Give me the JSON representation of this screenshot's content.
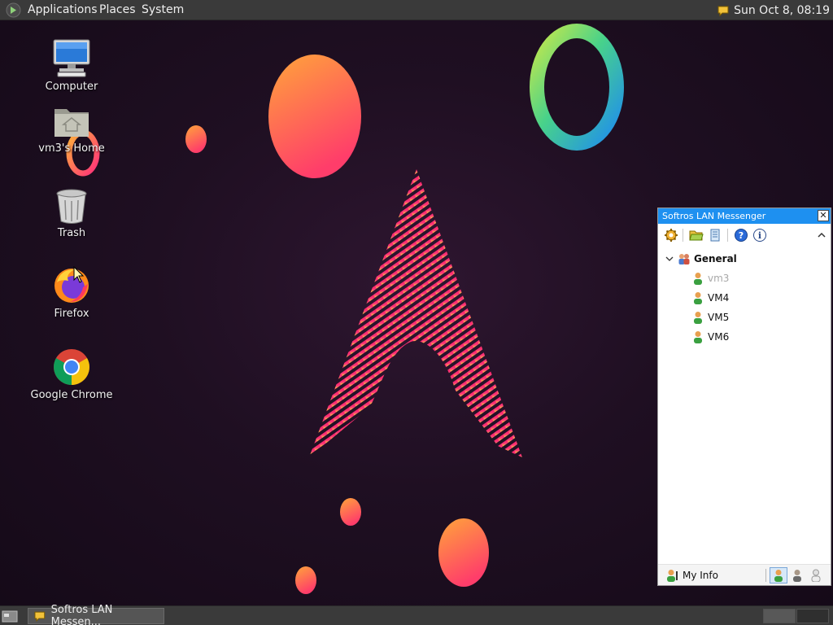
{
  "top_panel": {
    "menus": [
      "Applications",
      "Places",
      "System"
    ],
    "clock": "Sun Oct  8, 08:19",
    "tray_icon": "chat-bubble-icon"
  },
  "desktop_icons": [
    {
      "label": "Computer",
      "icon": "computer-icon"
    },
    {
      "label": "vm3's Home",
      "icon": "home-folder-icon"
    },
    {
      "label": "Trash",
      "icon": "trash-icon"
    },
    {
      "label": "Firefox",
      "icon": "firefox-icon"
    },
    {
      "label": "Google Chrome",
      "icon": "chrome-icon"
    }
  ],
  "messenger": {
    "title": "Softros LAN Messenger",
    "close_glyph": "✕",
    "toolbar": [
      "settings-gear-icon",
      "open-folder-icon",
      "history-icon",
      "help-icon",
      "info-icon",
      "collapse-icon"
    ],
    "group": {
      "name": "General",
      "expanded": true
    },
    "users": [
      {
        "name": "vm3",
        "self": true
      },
      {
        "name": "VM4",
        "self": false
      },
      {
        "name": "VM5",
        "self": false
      },
      {
        "name": "VM6",
        "self": false
      }
    ],
    "my_info_label": "My Info",
    "status_buttons": [
      "status-available-icon",
      "status-busy-icon",
      "status-offline-icon"
    ],
    "active_status": "status-available-icon"
  },
  "taskbar": {
    "tasks": [
      {
        "label": "Softros LAN Messen...",
        "icon": "chat-bubble-icon"
      }
    ],
    "workspaces": 2,
    "active_workspace": 1
  },
  "colors": {
    "panel": "#3a3a3a",
    "titlebar": "#1e90f0",
    "wallpaper_dark": "#1f0f22",
    "accent_pink": "#ff2a8a",
    "accent_orange": "#ff9a3a"
  }
}
